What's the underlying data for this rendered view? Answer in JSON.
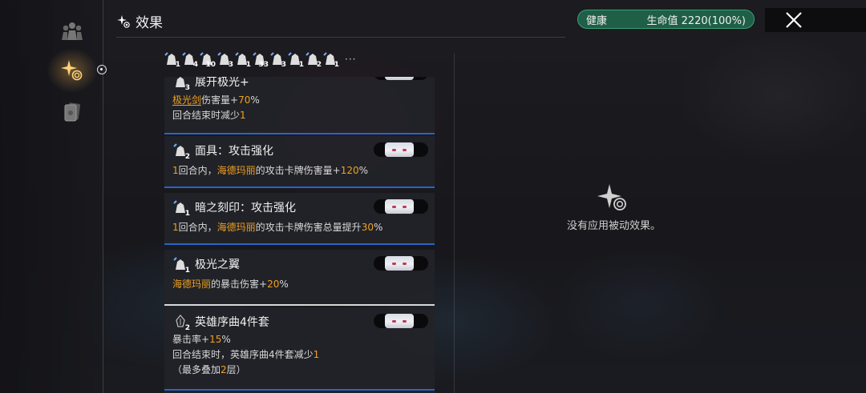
{
  "header": {
    "title": "效果"
  },
  "status": {
    "label": "健康",
    "hp": "生命值 2220(100%)",
    "color": "#1f5e47"
  },
  "strip": {
    "icons": [
      {
        "name": "buff-icon-1",
        "count": "1"
      },
      {
        "name": "buff-icon-2",
        "count": "4"
      },
      {
        "name": "buff-icon-3",
        "count": "10"
      },
      {
        "name": "buff-icon-4",
        "count": "3"
      },
      {
        "name": "buff-icon-5",
        "count": "1"
      },
      {
        "name": "buff-icon-6",
        "count": "33"
      },
      {
        "name": "buff-icon-7",
        "count": "3"
      },
      {
        "name": "buff-icon-8",
        "count": "1"
      },
      {
        "name": "buff-icon-9",
        "count": "2"
      },
      {
        "name": "buff-icon-10",
        "count": "1"
      }
    ],
    "more": "···"
  },
  "effects": [
    {
      "title": "展开极光+",
      "count": "3",
      "line1_a": "极光剑",
      "line1_b": "伤害量+",
      "line1_c": "70",
      "line1_d": "%",
      "line2_a": "回合结束时减少",
      "line2_b": "1"
    },
    {
      "title": "面具：攻击强化",
      "count": "2",
      "line1_a": "1",
      "line1_b": "回合内，",
      "line1_c": "海德玛丽",
      "line1_d": "的攻击卡牌伤害量+",
      "line1_e": "120",
      "line1_f": "%"
    },
    {
      "title": "暗之刻印：攻击强化",
      "count": "1",
      "line1_a": "1",
      "line1_b": "回合内，",
      "line1_c": "海德玛丽",
      "line1_d": "的攻击卡牌伤害总量提升",
      "line1_e": "30",
      "line1_f": "%"
    },
    {
      "title": "极光之翼",
      "count": "1",
      "line1_a": "海德玛丽",
      "line1_b": "的暴击伤害+",
      "line1_c": "20",
      "line1_d": "%"
    },
    {
      "title": "英雄序曲4件套",
      "count": "2",
      "line1_a": "暴击率+",
      "line1_b": "15",
      "line1_c": "%",
      "line2_a": "回合结束时，英雄序曲4件套减少",
      "line2_b": "1",
      "line3_a": "（最多叠加",
      "line3_b": "2",
      "line3_c": "层）"
    }
  ],
  "passive": {
    "empty_text": "没有应用被动效果。"
  },
  "colors": {
    "highlight": "#f0a020",
    "accent_blue": "#2a63c9"
  }
}
